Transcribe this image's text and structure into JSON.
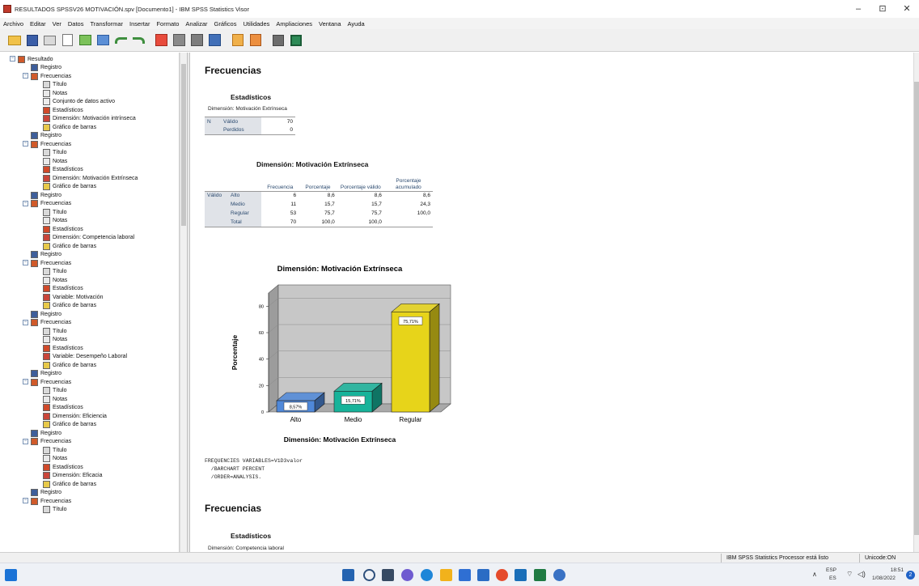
{
  "window": {
    "title": "RESULTADOS SPSSV26 MOTIVACIÓN.spv [Documento1] - IBM SPSS Statistics Visor",
    "minimize": "–",
    "maximize": "⊡",
    "close": "✕"
  },
  "menu": [
    "Archivo",
    "Editar",
    "Ver",
    "Datos",
    "Transformar",
    "Insertar",
    "Formato",
    "Analizar",
    "Gráficos",
    "Utilidades",
    "Ampliaciones",
    "Ventana",
    "Ayuda"
  ],
  "nav": {
    "root": "Resultado",
    "groups": [
      {
        "registro": "Registro",
        "frec": "Frecuencias",
        "items": [
          "Título",
          "Notas",
          "Conjunto de datos activo",
          "Estadísticos",
          "Dimensión: Motivación intrínseca",
          "Gráfico de barras"
        ]
      },
      {
        "registro": "Registro",
        "frec": "Frecuencias",
        "items": [
          "Título",
          "Notas",
          "Estadísticos",
          "Dimensión: Motivación Extrínseca",
          "Gráfico de barras"
        ]
      },
      {
        "registro": "Registro",
        "frec": "Frecuencias",
        "items": [
          "Título",
          "Notas",
          "Estadísticos",
          "Dimensión: Competencia laboral",
          "Gráfico de barras"
        ]
      },
      {
        "registro": "Registro",
        "frec": "Frecuencias",
        "items": [
          "Título",
          "Notas",
          "Estadísticos",
          "Variable: Motivación",
          "Gráfico de barras"
        ]
      },
      {
        "registro": "Registro",
        "frec": "Frecuencias",
        "items": [
          "Título",
          "Notas",
          "Estadísticos",
          "Variable: Desempeño Laboral",
          "Gráfico de barras"
        ]
      },
      {
        "registro": "Registro",
        "frec": "Frecuencias",
        "items": [
          "Título",
          "Notas",
          "Estadísticos",
          "Dimensión: Eficiencia",
          "Gráfico de barras"
        ]
      },
      {
        "registro": "Registro",
        "frec": "Frecuencias",
        "items": [
          "Título",
          "Notas",
          "Estadísticos",
          "Dimensión: Eficacia",
          "Gráfico de barras"
        ]
      },
      {
        "registro": "Registro",
        "frec": "Frecuencias",
        "items": [
          "Título"
        ]
      }
    ]
  },
  "output": {
    "heading1": "Frecuencias",
    "stats_title": "Estadísticos",
    "stats_caption": "Dimensión: Motivación Extrínseca",
    "stats_rows": [
      {
        "a": "N",
        "b": "Válido",
        "v": "70"
      },
      {
        "a": "",
        "b": "Perdidos",
        "v": "0"
      }
    ],
    "freq_title": "Dimensión: Motivación Extrínseca",
    "freq_headers": {
      "f": "Frecuencia",
      "p": "Porcentaje",
      "pv": "Porcentaje válido",
      "pa": "Porcentaje acumulado"
    },
    "freq_rows": [
      {
        "g": "Válido",
        "c": "Alto",
        "f": "6",
        "p": "8,6",
        "pv": "8,6",
        "pa": "8,6"
      },
      {
        "g": "",
        "c": "Medio",
        "f": "11",
        "p": "15,7",
        "pv": "15,7",
        "pa": "24,3"
      },
      {
        "g": "",
        "c": "Regular",
        "f": "53",
        "p": "75,7",
        "pv": "75,7",
        "pa": "100,0"
      },
      {
        "g": "",
        "c": "Total",
        "f": "70",
        "p": "100,0",
        "pv": "100,0",
        "pa": ""
      }
    ],
    "syntax": [
      "FREQUENCIES VARIABLES=V1D3valor",
      "  /BARCHART PERCENT",
      "  /ORDER=ANALYSIS."
    ],
    "heading2": "Frecuencias",
    "stats_title2": "Estadísticos",
    "stats_caption2": "Dimensión: Competencia laboral"
  },
  "chart_data": {
    "type": "bar",
    "title": "Dimensión: Motivación Extrínseca",
    "xlabel": "Dimensión: Motivación Extrínseca",
    "ylabel": "Porcentaje",
    "categories": [
      "Alto",
      "Medio",
      "Regular"
    ],
    "values": [
      8.57,
      15.71,
      75.71
    ],
    "data_labels": [
      "8,57%",
      "15,71%",
      "75,71%"
    ],
    "yticks": [
      0,
      20,
      40,
      60,
      80
    ],
    "ylim": [
      0,
      90
    ],
    "colors": [
      "#4f88d9",
      "#17b39a",
      "#e7d41a"
    ]
  },
  "status": {
    "processor": "IBM SPSS Statistics Processor está listo",
    "unicode": "Unicode:ON"
  },
  "tray": {
    "lang": "ESP",
    "region": "ES",
    "time": "18:51",
    "date": "1/08/2022",
    "badge": "2"
  }
}
